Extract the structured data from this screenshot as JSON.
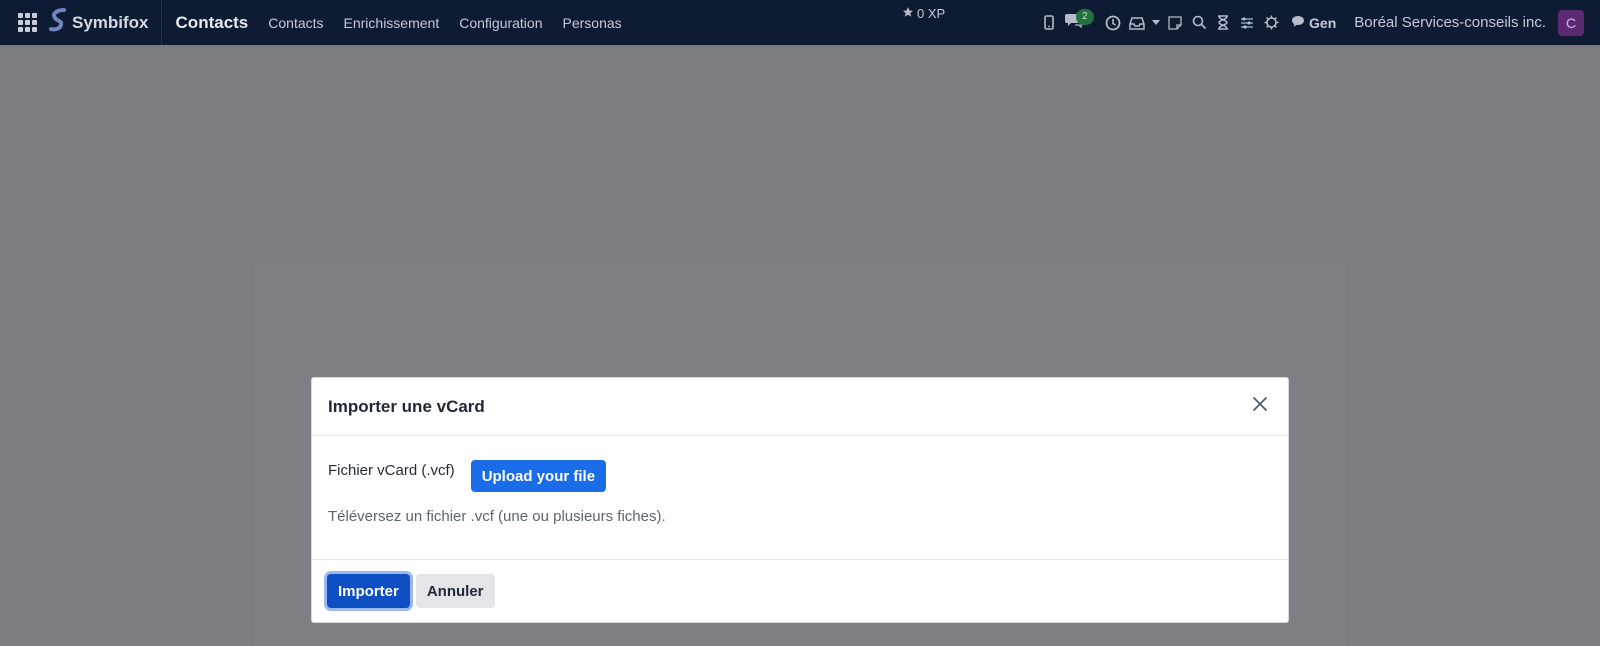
{
  "navbar": {
    "brand": "Symbifox",
    "app_name": "Contacts",
    "menu": [
      {
        "label": "Contacts"
      },
      {
        "label": "Enrichissement"
      },
      {
        "label": "Configuration"
      },
      {
        "label": "Personas"
      }
    ],
    "xp": "0 XP",
    "chat_badge": "2",
    "gen_label": "Gen",
    "company": "Boréal Services-conseils inc.",
    "avatar_initial": "C"
  },
  "modal": {
    "title": "Importer une vCard",
    "field_label": "Fichier vCard (.vcf)",
    "upload_label": "Upload your file",
    "hint": "Téléversez un fichier .vcf (une ou plusieurs fiches).",
    "import_label": "Importer",
    "cancel_label": "Annuler"
  },
  "colors": {
    "navbar_bg": "#0f1a33",
    "primary": "#1a6ce8",
    "avatar_bg": "#5b2a72",
    "badge_bg": "#24703f"
  },
  "icons": [
    "apps-grid-icon",
    "symbifox-logo-icon",
    "star-icon",
    "phone-icon",
    "chat-icon",
    "clock-icon",
    "inbox-icon",
    "caret-down-icon",
    "note-icon",
    "search-icon",
    "hourglass-icon",
    "sliders-icon",
    "gear-icon",
    "speech-bubble-icon",
    "close-icon"
  ]
}
